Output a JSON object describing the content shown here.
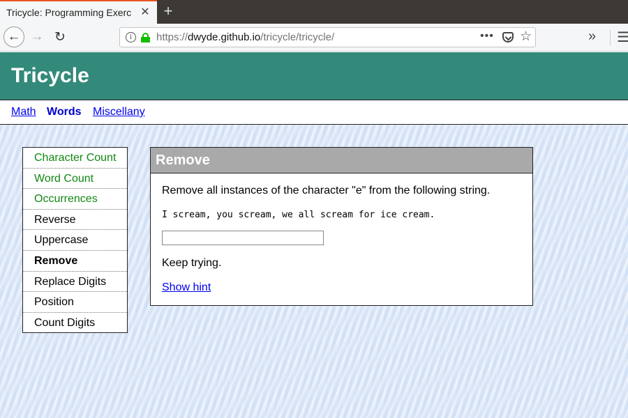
{
  "browser": {
    "tab_title": "Tricycle: Programming Exerc",
    "tab_close": "✕",
    "new_tab": "+",
    "url_scheme": "https://",
    "url_host": "dwyde.github.io",
    "url_path": "/tricycle/tricycle/",
    "page_actions": "•••",
    "overflow": "»",
    "menu": "☰"
  },
  "site": {
    "title": "Tricycle",
    "nav": [
      {
        "label": "Math"
      },
      {
        "label": "Words"
      },
      {
        "label": "Miscellany"
      }
    ]
  },
  "sidebar": {
    "items": [
      {
        "label": "Character Count",
        "status": "completed"
      },
      {
        "label": "Word Count",
        "status": "completed"
      },
      {
        "label": "Occurrences",
        "status": "completed"
      },
      {
        "label": "Reverse",
        "status": "pending"
      },
      {
        "label": "Uppercase",
        "status": "pending"
      },
      {
        "label": "Remove",
        "status": "current"
      },
      {
        "label": "Replace Digits",
        "status": "pending"
      },
      {
        "label": "Position",
        "status": "pending"
      },
      {
        "label": "Count Digits",
        "status": "pending"
      }
    ]
  },
  "exercise": {
    "title": "Remove",
    "prompt": "Remove all instances of the character \"e\" from the following string.",
    "input_string": "I scream, you scream, we all scream for ice cream.",
    "answer_value": "",
    "feedback": "Keep trying.",
    "hint_link": "Show hint"
  },
  "colors": {
    "header_bg": "#338a7a",
    "completed_text": "#118811",
    "link": "#0000ee",
    "panel_header_bg": "#a9a9a9"
  }
}
